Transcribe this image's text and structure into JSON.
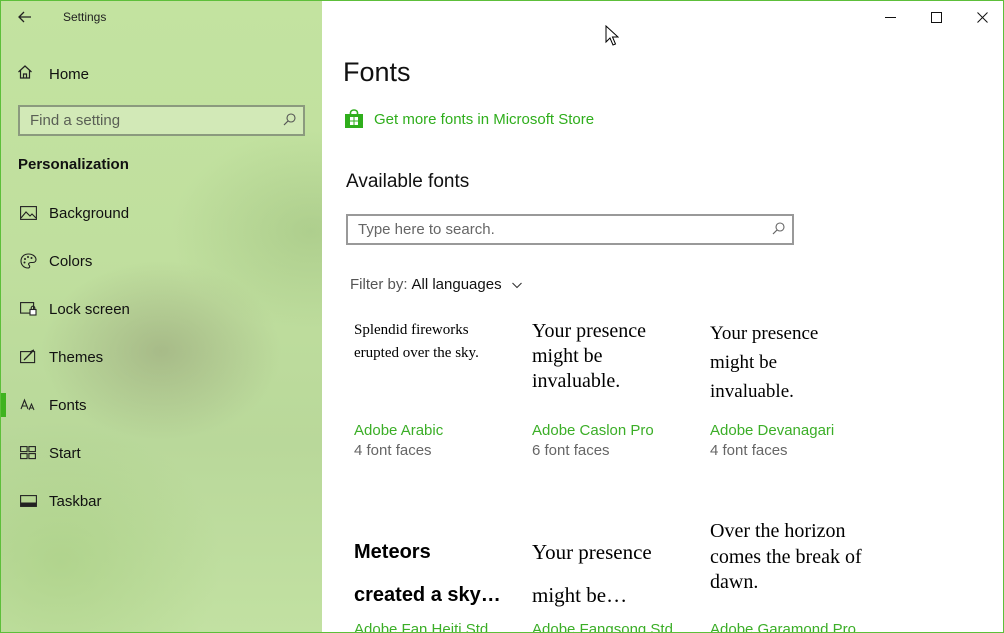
{
  "app": {
    "title": "Settings"
  },
  "sidebar": {
    "home_label": "Home",
    "search_placeholder": "Find a setting",
    "section_title": "Personalization",
    "items": [
      {
        "label": "Background",
        "icon": "picture-icon",
        "active": false
      },
      {
        "label": "Colors",
        "icon": "palette-icon",
        "active": false
      },
      {
        "label": "Lock screen",
        "icon": "lock-screen-icon",
        "active": false
      },
      {
        "label": "Themes",
        "icon": "brush-icon",
        "active": false
      },
      {
        "label": "Fonts",
        "icon": "font-icon",
        "active": true
      },
      {
        "label": "Start",
        "icon": "start-icon",
        "active": false
      },
      {
        "label": "Taskbar",
        "icon": "taskbar-icon",
        "active": false
      }
    ]
  },
  "main": {
    "title": "Fonts",
    "store_link": "Get more fonts in Microsoft Store",
    "available_title": "Available fonts",
    "search_placeholder": "Type here to search.",
    "filter_label": "Filter by:",
    "filter_value": "All languages",
    "fonts": [
      {
        "sample": "Splendid fireworks erupted over the sky.",
        "name": "Adobe Arabic",
        "faces": "4 font faces"
      },
      {
        "sample": "Your presence might be invaluable.",
        "name": "Adobe Caslon Pro",
        "faces": "6 font faces"
      },
      {
        "sample": "Your presence might be invaluable.",
        "name": "Adobe Devanagari",
        "faces": "4 font faces"
      },
      {
        "sample": "Meteors created a sky…",
        "name": "Adobe Fan Heiti Std",
        "faces": ""
      },
      {
        "sample": "Your presence might be…",
        "name": "Adobe Fangsong Std",
        "faces": ""
      },
      {
        "sample": "Over the horizon comes the break of dawn.",
        "name": "Adobe Garamond Pro",
        "faces": ""
      }
    ]
  },
  "colors": {
    "accent": "#3fb31f",
    "link": "#2fae1c"
  }
}
